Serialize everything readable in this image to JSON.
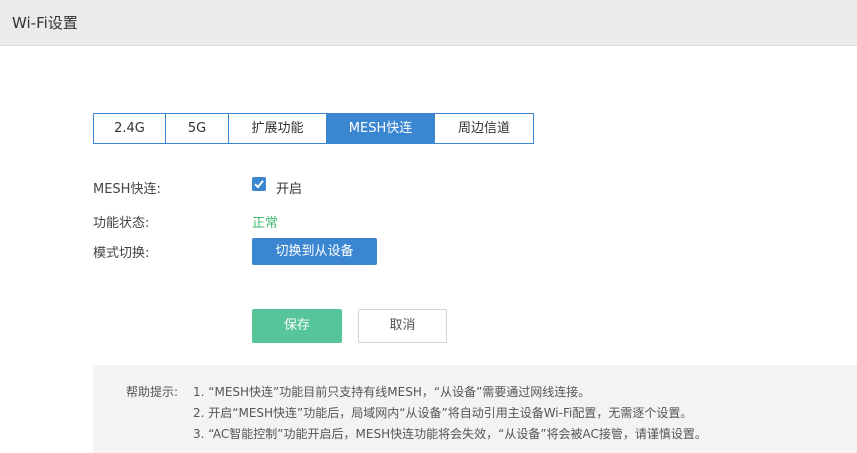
{
  "header": {
    "title": "Wi-Fi设置"
  },
  "tabs": [
    {
      "label": "2.4G",
      "active": false
    },
    {
      "label": "5G",
      "active": false
    },
    {
      "label": "扩展功能",
      "active": false
    },
    {
      "label": "MESH快连",
      "active": true
    },
    {
      "label": "周边信道",
      "active": false
    }
  ],
  "form": {
    "mesh_label": "MESH快连:",
    "mesh_checkbox_text": "开启",
    "mesh_checked": true,
    "status_label": "功能状态:",
    "status_value": "正常",
    "mode_label": "模式切换:",
    "mode_button": "切换到从设备"
  },
  "actions": {
    "save": "保存",
    "cancel": "取消"
  },
  "help": {
    "title": "帮助提示:",
    "lines": [
      "1. “MESH快连”功能目前只支持有线MESH，“从设备”需要通过网线连接。",
      "2. 开启“MESH快连”功能后，局域网内“从设备”将自动引用主设备Wi-Fi配置，无需逐个设置。",
      "3. “AC智能控制”功能开启后，MESH快连功能将会失效，“从设备”将会被AC接管，请谨慎设置。"
    ]
  },
  "colors": {
    "accent": "#3a86d0",
    "save": "#56c69a",
    "status_ok": "#3fb96f",
    "header_bg": "#ebebeb",
    "help_bg": "#f3f3f3"
  }
}
